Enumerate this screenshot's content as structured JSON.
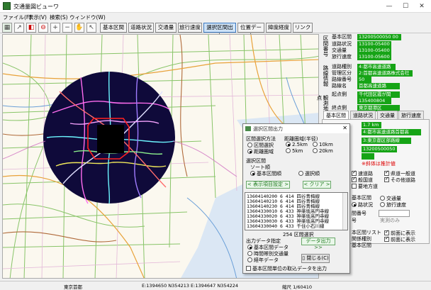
{
  "window": {
    "title": "交通量図ビューワ"
  },
  "menu": [
    {
      "label": "ファイル(F)"
    },
    {
      "label": "表示(V)"
    },
    {
      "label": "検索(S)"
    },
    {
      "label": "ウィンドウ(W)"
    }
  ],
  "toolbar": {
    "buttons": [
      {
        "label": "基本区間"
      },
      {
        "label": "道路状況"
      },
      {
        "label": "交通量"
      },
      {
        "label": "旅行速度"
      },
      {
        "label": "選択区間出力"
      },
      {
        "label": "位置データ"
      },
      {
        "label": "緯度経度"
      },
      {
        "label": "リンク"
      }
    ]
  },
  "statusbar": {
    "left": "東京首都",
    "coords": "E:1394650 N354213  E:1394647 N354224",
    "scale": "縮尺 1/60410"
  },
  "panel": {
    "section_label_1": "区間番号",
    "rows_top": [
      {
        "key": "基本区間",
        "value": "13200500050 00"
      },
      {
        "key": "道路状況",
        "value": "13100-05400"
      },
      {
        "key": "交通量",
        "value": "13100-05400"
      },
      {
        "key": "旅行速度",
        "value": "13100-05600"
      }
    ],
    "section_label_2": "路線情報",
    "rows_route": [
      {
        "key": "道路種別",
        "value": "4:都市高速道路"
      },
      {
        "key": "管理区分",
        "value": "2:首都高速道路株式会社"
      },
      {
        "key": "路線番号",
        "value": "50"
      },
      {
        "key": "路線名",
        "value": "首都高速道路"
      }
    ],
    "section_label_3": "観測地点",
    "rows_points": [
      {
        "key": "起点側",
        "value": "千代田区霞が関"
      },
      {
        "key": "",
        "value": "135400804"
      },
      {
        "key": "終点側",
        "value": "東京都港区"
      }
    ],
    "tabs": [
      {
        "label": "基本区間"
      },
      {
        "label": "道路状況"
      },
      {
        "label": "交通量"
      },
      {
        "label": "旅行速度"
      }
    ],
    "detail_values": [
      {
        "value": "1.7 km"
      },
      {
        "value": "4:都市高速道路首都高"
      },
      {
        "value": "3:東京都区部路線"
      },
      {
        "value": "13200500050"
      }
    ],
    "note": "※斜体は推計値",
    "checks_road": [
      {
        "label": "速道路",
        "checked": true
      },
      {
        "label": "県道一般道",
        "checked": true
      },
      {
        "label": "般国道",
        "checked": true
      },
      {
        "label": "その他道路",
        "checked": true
      },
      {
        "label": "要地方道",
        "checked": false
      }
    ],
    "section_radio_label": "基本区間",
    "radios_mid": [
      {
        "label": "交通量",
        "checked": false
      },
      {
        "label": "旅行速度",
        "checked": false
      },
      {
        "label": "路状況",
        "checked": true
      }
    ],
    "field_labels": [
      {
        "label": "間番号"
      },
      {
        "label": "号"
      }
    ],
    "field_values": [
      {
        "value": "実測のみ"
      }
    ],
    "bottom_labels": [
      {
        "label": "本区間リスト"
      },
      {
        "label": "関係種別"
      },
      {
        "label": "基本区間"
      }
    ],
    "bottom_checks": [
      {
        "label": "前面に表示",
        "checked": true
      },
      {
        "label": "前面に表示",
        "checked": true
      }
    ]
  },
  "dialog": {
    "title": "選択区間出力",
    "method_label": "区間選択方法",
    "methods": [
      {
        "label": "区間選択",
        "checked": false
      },
      {
        "label": "距離圏域",
        "checked": true
      }
    ],
    "radius_label": "距離圏域(半径)",
    "radii": [
      {
        "label": "2.5km",
        "checked": true
      },
      {
        "label": "10km",
        "checked": false
      },
      {
        "label": "5km",
        "checked": false
      },
      {
        "label": "20km",
        "checked": false
      }
    ],
    "section_label": "選択区間",
    "sort_label": "ソート順",
    "sorts": [
      {
        "label": "基本区間順",
        "checked": true
      },
      {
        "label": "選択順",
        "checked": false
      }
    ],
    "display_settings": "< 表示項目設定 >",
    "clear_button": "< クリア >",
    "list_rows": [
      {
        "text": "13604140200 6  414 四谷青梅線"
      },
      {
        "text": "13604140210 6  414 四谷青梅線"
      },
      {
        "text": "13604140230 6  414 四谷青梅線"
      },
      {
        "text": "13604330010 6  433 神楽坂高円寺線"
      },
      {
        "text": "13604330020 6  433 神楽坂高円寺線"
      },
      {
        "text": "13604330030 6  433 神楽坂高円寺線"
      },
      {
        "text": "13604330040 6  433 千住小石川線"
      }
    ],
    "count_label": "254 区間選択",
    "output_label": "出力データ指定",
    "outputs": [
      {
        "label": "基本区間データ",
        "checked": true
      },
      {
        "label": "時間帯別交通量",
        "checked": false
      },
      {
        "label": "経年データ",
        "checked": false
      }
    ],
    "output_button": "データ出力 >>",
    "close_button": "閉じる(C)",
    "checkbox_label": "基本区間単位の取込データを出力"
  }
}
